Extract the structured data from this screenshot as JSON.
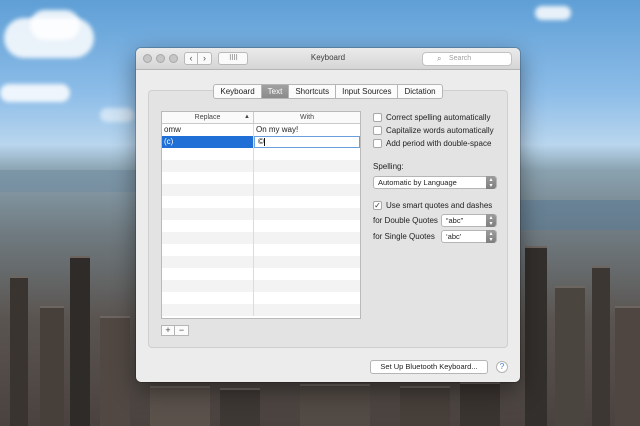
{
  "window": {
    "title": "Keyboard",
    "search_placeholder": "Search",
    "grid_icon": "grid-icon"
  },
  "tabs": [
    {
      "label": "Keyboard",
      "active": false
    },
    {
      "label": "Text",
      "active": true
    },
    {
      "label": "Shortcuts",
      "active": false
    },
    {
      "label": "Input Sources",
      "active": false
    },
    {
      "label": "Dictation",
      "active": false
    }
  ],
  "table": {
    "headers": {
      "replace": "Replace",
      "with": "With"
    },
    "rows": [
      {
        "replace": "omw",
        "with": "On my way!",
        "selected": false
      },
      {
        "replace": "(c)",
        "with": "©",
        "selected": true,
        "editing": true
      }
    ]
  },
  "options": {
    "correct_spelling": {
      "label": "Correct spelling automatically",
      "checked": false
    },
    "capitalize": {
      "label": "Capitalize words automatically",
      "checked": false
    },
    "add_period": {
      "label": "Add period with double-space",
      "checked": false
    },
    "spelling_label": "Spelling:",
    "spelling_value": "Automatic by Language",
    "smart_quotes": {
      "label": "Use smart quotes and dashes",
      "checked": true
    },
    "double_quotes_label": "for Double Quotes",
    "double_quotes_value": "“abc”",
    "single_quotes_label": "for Single Quotes",
    "single_quotes_value": "‘abc’"
  },
  "buttons": {
    "add": "+",
    "remove": "−",
    "bluetooth": "Set Up Bluetooth Keyboard...",
    "help": "?"
  }
}
